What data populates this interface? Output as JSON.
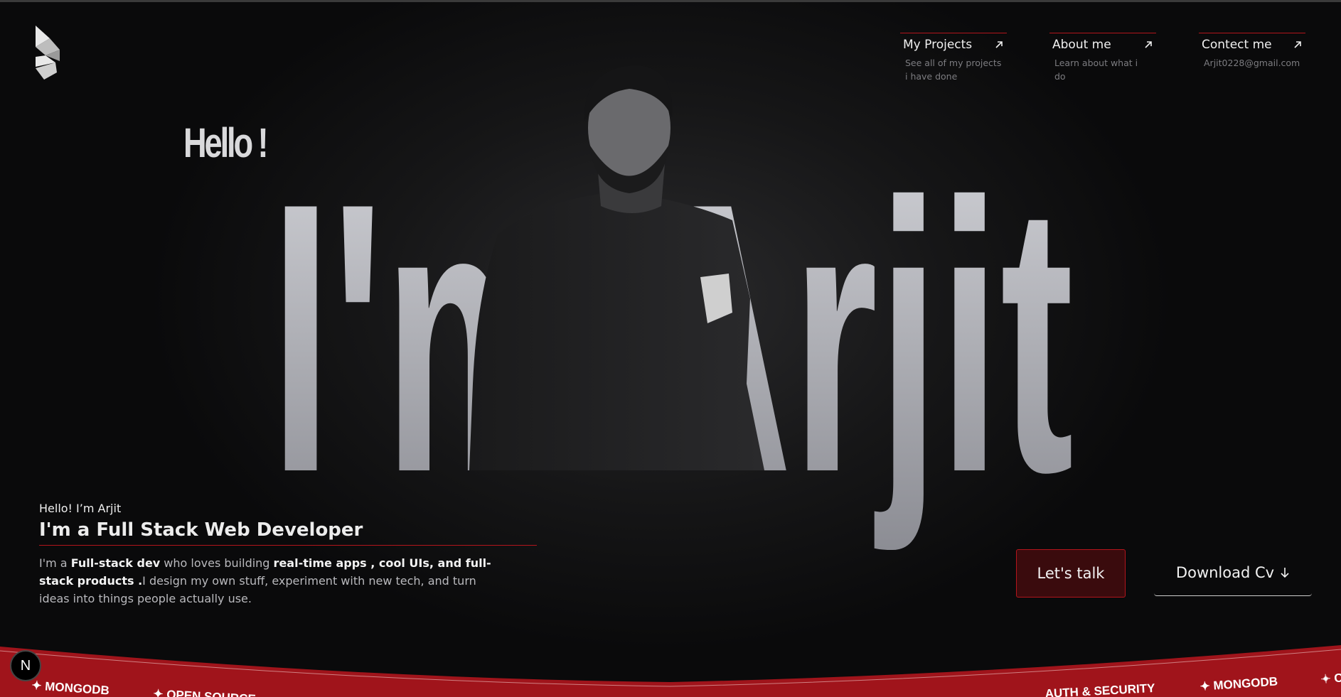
{
  "nav": [
    {
      "label": "My Projects",
      "desc": "See all of my projects i have done"
    },
    {
      "label": "About me",
      "desc": "Learn about what i do"
    },
    {
      "label": "Contect me",
      "desc": "Arjit0228@gmail.com"
    }
  ],
  "hero": {
    "hello": "Hello !",
    "big_name": "I'm Arjit"
  },
  "intro": {
    "greeting": "Hello! I’m Arjit",
    "title": "I'm a Full Stack Web Developer",
    "desc_1": "I'm a ",
    "desc_2": "Full-stack dev",
    "desc_3": " who loves building ",
    "desc_4": "real-time apps , cool UIs, and full-stack products .",
    "desc_5": "I design my own stuff, experiment with new tech, and turn ideas into things people actually use."
  },
  "buttons": {
    "talk": "Let's talk",
    "cv": "Download Cv"
  },
  "marquee": {
    "left_items": [
      "✦ MONGODB",
      "✦ OPEN SOURCE"
    ],
    "right_items": [
      "AUTH & SECURITY",
      "✦ MONGODB",
      "✦ C"
    ]
  },
  "badge": "N",
  "colors": {
    "accent": "#b3151c",
    "background": "#0b0b0c"
  }
}
